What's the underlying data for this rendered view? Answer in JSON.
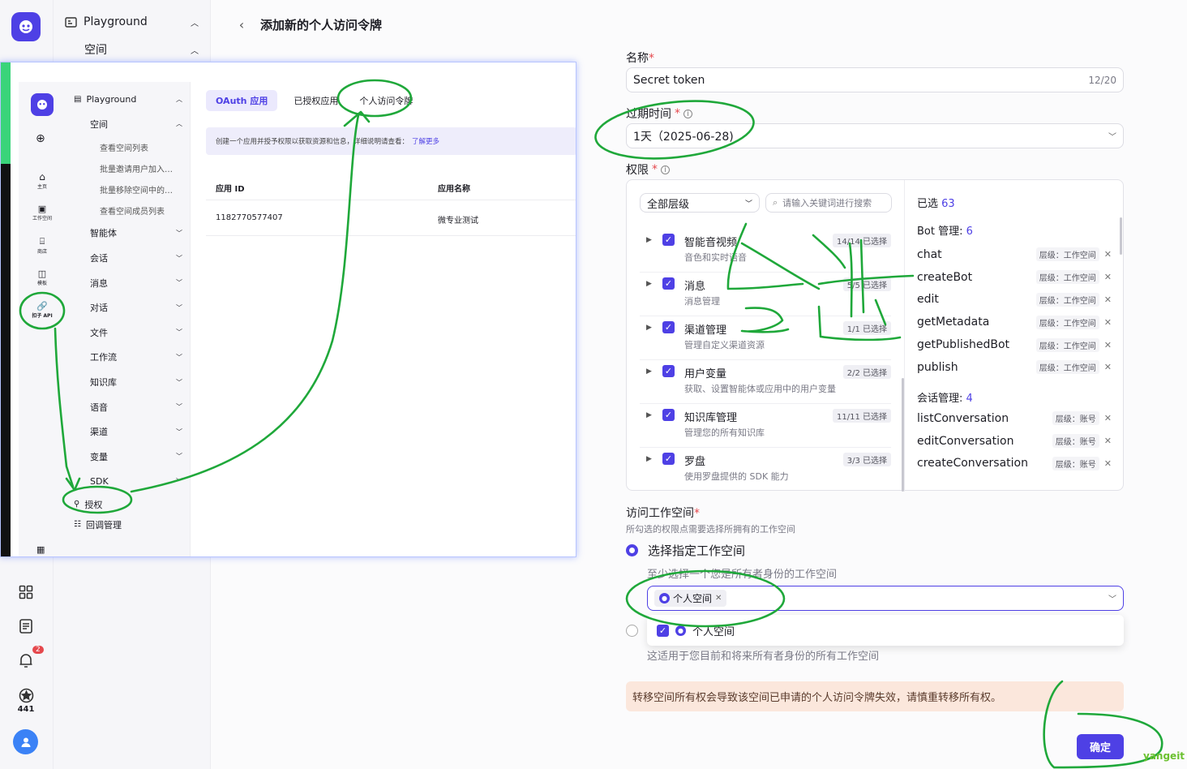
{
  "rail": {
    "counter": "441",
    "notification_badge": "2"
  },
  "sidebar": {
    "playground": "Playground",
    "space": "空间"
  },
  "header": {
    "title": "添加新的个人访问令牌"
  },
  "form": {
    "name_label": "名称",
    "name_value": "Secret token",
    "name_count": "12/20",
    "expire_label": "过期时间",
    "expire_value": "1天（2025-06-28)",
    "perm_label": "权限",
    "level_select": "全部层级",
    "search_placeholder": "请输入关键词进行搜索",
    "selected_label": "已选",
    "selected_count": "63",
    "categories": [
      {
        "title": "智能音视频",
        "desc": "音色和实时语音",
        "tag": "14/14 已选择"
      },
      {
        "title": "消息",
        "desc": "消息管理",
        "tag": "5/5 已选择"
      },
      {
        "title": "渠道管理",
        "desc": "管理自定义渠道资源",
        "tag": "1/1 已选择"
      },
      {
        "title": "用户变量",
        "desc": "获取、设置智能体或应用中的用户变量",
        "tag": "2/2 已选择"
      },
      {
        "title": "知识库管理",
        "desc": "管理您的所有知识库",
        "tag": "11/11 已选择"
      },
      {
        "title": "罗盘",
        "desc": "使用罗盘提供的 SDK 能力",
        "tag": "3/3 已选择"
      }
    ],
    "groups": [
      {
        "title": "Bot 管理:",
        "count": "6",
        "items": [
          {
            "name": "chat",
            "scope": "层级：工作空间"
          },
          {
            "name": "createBot",
            "scope": "层级：工作空间"
          },
          {
            "name": "edit",
            "scope": "层级：工作空间"
          },
          {
            "name": "getMetadata",
            "scope": "层级：工作空间"
          },
          {
            "name": "getPublishedBot",
            "scope": "层级：工作空间"
          },
          {
            "name": "publish",
            "scope": "层级：工作空间"
          }
        ]
      },
      {
        "title": "会话管理:",
        "count": "4",
        "items": [
          {
            "name": "listConversation",
            "scope": "层级：账号"
          },
          {
            "name": "editConversation",
            "scope": "层级：账号"
          },
          {
            "name": "createConversation",
            "scope": "层级：账号"
          }
        ]
      }
    ],
    "workspace_label": "访问工作空间",
    "workspace_hint": "所勾选的权限点需要选择所拥有的工作空间",
    "option_specific": "选择指定工作空间",
    "option_specific_hint": "至少选择一个您是所有者身份的工作空间",
    "chip": "个人空间",
    "dropdown_item": "个人空间",
    "option_all_hint": "这适用于您目前和将来所有者身份的所有工作空间",
    "warning": "转移空间所有权会导致该空间已申请的个人访问令牌失效，请慎重转移所有权。",
    "confirm": "确定"
  },
  "overlay": {
    "sidebar": {
      "playground": "Playground",
      "space": "空间",
      "sub_items": [
        "查看空间列表",
        "批量邀请用户加入…",
        "批量移除空间中的…",
        "查看空间成员列表"
      ],
      "items": [
        "智能体",
        "会话",
        "消息",
        "对话",
        "文件",
        "工作流",
        "知识库",
        "语音",
        "渠道",
        "变量",
        "SDK"
      ],
      "auth": "授权",
      "callback": "回调管理"
    },
    "rail": {
      "home": "主页",
      "workspace": "工作空间",
      "store": "商店",
      "template": "模板",
      "api": "扣子 API"
    },
    "tabs": [
      "OAuth 应用",
      "已授权应用",
      "个人访问令牌"
    ],
    "info": "创建一个应用并授予权限以获取资源和信息，详细说明请查看：",
    "info_link": "了解更多",
    "table": {
      "col_id": "应用 ID",
      "col_name": "应用名称",
      "row_id": "1182770577407",
      "row_name": "微专业测试"
    }
  },
  "annotations": {
    "handwriting": "全选",
    "watermark": "yangeit"
  },
  "colors": {
    "accent": "#4e40e5",
    "annotation": "#1fa83a",
    "warning_bg": "#fbe7dc"
  }
}
